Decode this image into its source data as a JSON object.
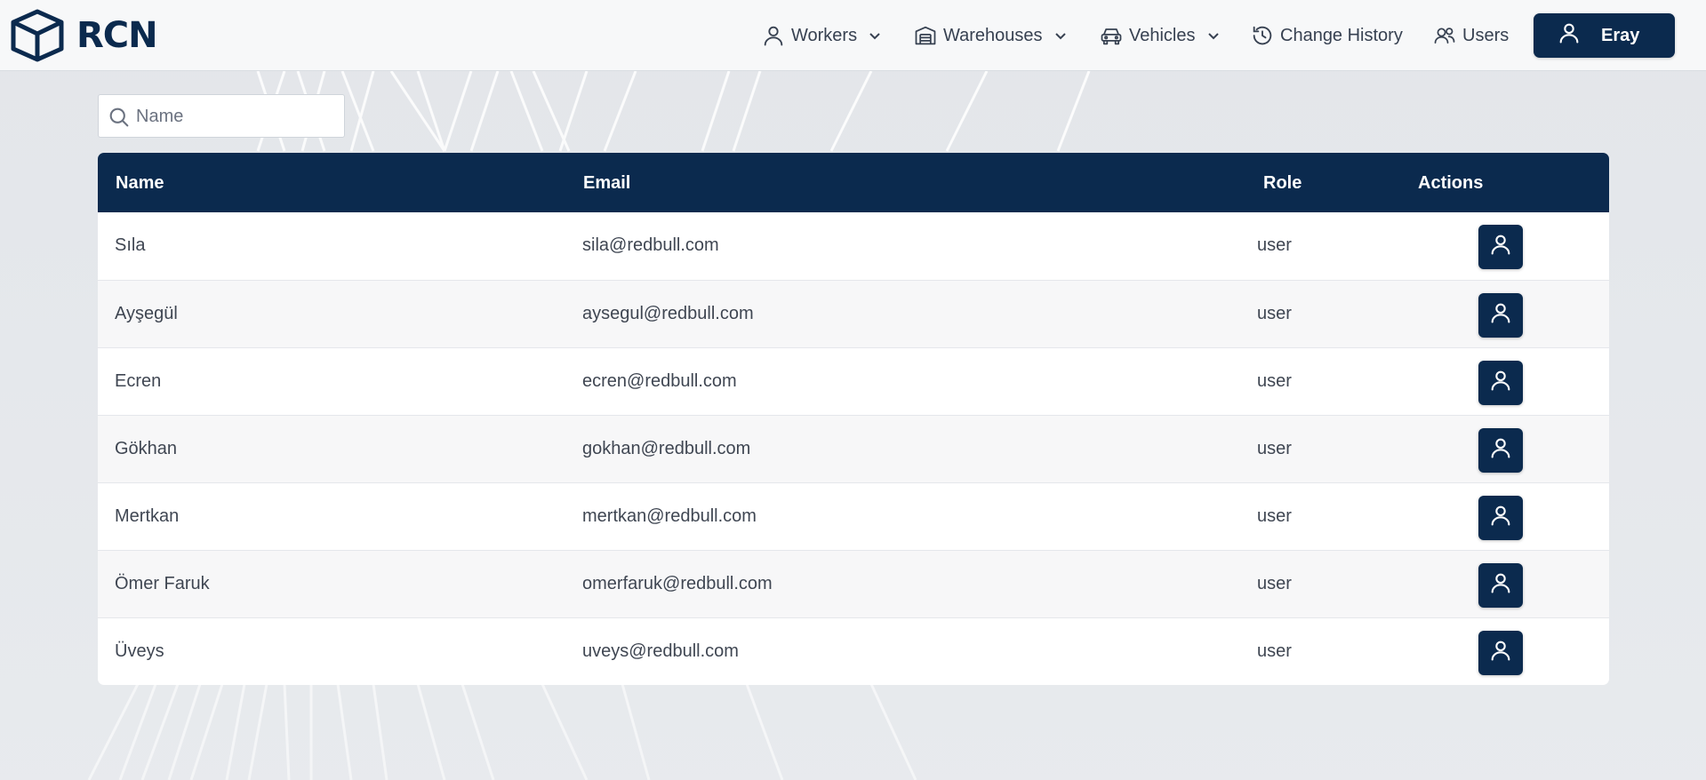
{
  "brand": {
    "name": "RCN",
    "logo_icon": "cube-icon"
  },
  "nav": {
    "workers": {
      "label": "Workers",
      "icon": "person-icon"
    },
    "warehouses": {
      "label": "Warehouses",
      "icon": "warehouse-icon"
    },
    "vehicles": {
      "label": "Vehicles",
      "icon": "car-icon"
    },
    "change_history": {
      "label": "Change History",
      "icon": "history-icon"
    },
    "users": {
      "label": "Users",
      "icon": "users-icon"
    },
    "account": {
      "label": "Eray",
      "icon": "person-icon"
    }
  },
  "search": {
    "placeholder": "Name",
    "value": ""
  },
  "table": {
    "headers": {
      "name": "Name",
      "email": "Email",
      "role": "Role",
      "actions": "Actions"
    },
    "rows": [
      {
        "name": "Sıla",
        "email": "sila@redbull.com",
        "role": "user"
      },
      {
        "name": "Ayşegül",
        "email": "aysegul@redbull.com",
        "role": "user"
      },
      {
        "name": "Ecren",
        "email": "ecren@redbull.com",
        "role": "user"
      },
      {
        "name": "Gökhan",
        "email": "gokhan@redbull.com",
        "role": "user"
      },
      {
        "name": "Mertkan",
        "email": "mertkan@redbull.com",
        "role": "user"
      },
      {
        "name": "Ömer Faruk",
        "email": "omerfaruk@redbull.com",
        "role": "user"
      },
      {
        "name": "Üveys",
        "email": "uveys@redbull.com",
        "role": "user"
      }
    ]
  },
  "colors": {
    "primary": "#0b2a4e",
    "background": "#e3e6ea",
    "row_alt": "#f7f7f8"
  }
}
